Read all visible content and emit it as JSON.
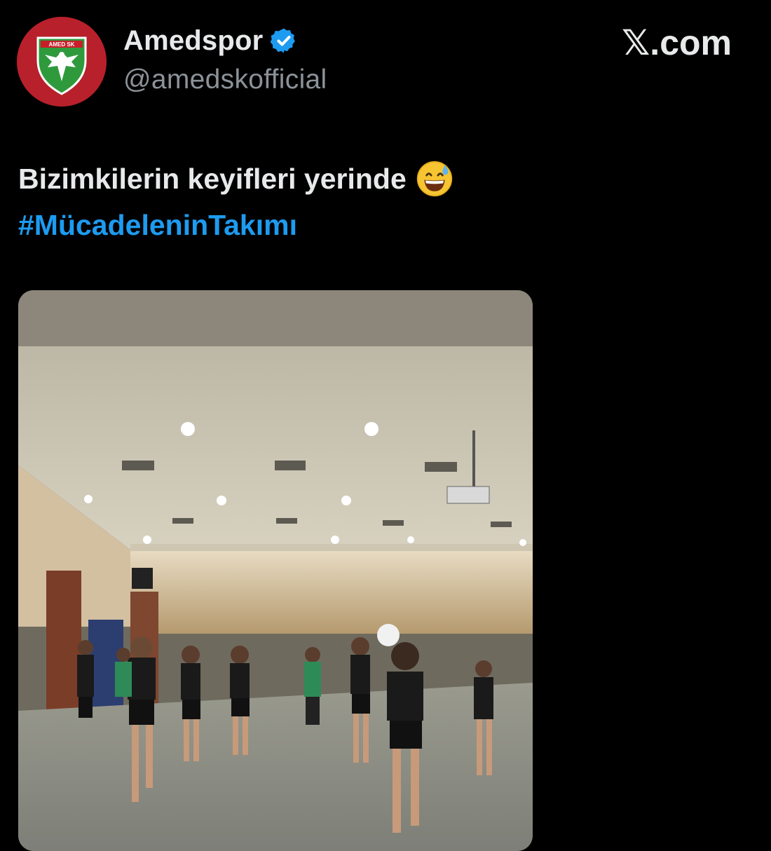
{
  "account": {
    "display_name": "Amedspor",
    "handle": "@amedskofficial",
    "verified": true,
    "avatar_icon": "amedspor-club-crest"
  },
  "brand": {
    "x_glyph": "𝕏",
    "domain": ".com"
  },
  "tweet": {
    "text": "Bizimkilerin keyifleri yerinde",
    "emoji": "grinning-face-with-sweat-emoji",
    "hashtag": "#MücadeleninTakımı"
  },
  "media": {
    "type": "video-still",
    "description_icon": "video-thumbnail"
  },
  "colors": {
    "background": "#000000",
    "text": "#e7e9ea",
    "handle": "#8b9299",
    "link": "#1d9bf0",
    "verified": "#1d9bf0",
    "avatar": "#b8202b"
  }
}
